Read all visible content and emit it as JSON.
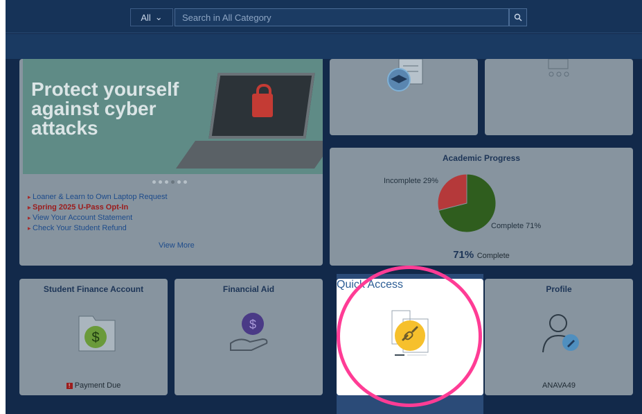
{
  "search": {
    "scope": "All",
    "placeholder": "Search in All Category"
  },
  "banner": {
    "headline": "Protect yourself against cyber attacks"
  },
  "links": [
    {
      "label": "Loaner & Learn to Own Laptop Request"
    },
    {
      "label": "Spring 2025 U-Pass Opt-In"
    },
    {
      "label": "View Your Account Statement"
    },
    {
      "label": "Check Your Student Refund"
    }
  ],
  "view_more": "View More",
  "academic_progress": {
    "title": "Academic Progress",
    "incomplete_label": "Incomplete 29%",
    "complete_label": "Complete 71%",
    "percent": "71%",
    "percent_suffix": "Complete",
    "colors": {
      "complete": "#2f5d1e",
      "incomplete": "#b5393a"
    }
  },
  "chart_data": {
    "type": "pie",
    "categories": [
      "Complete",
      "Incomplete"
    ],
    "values": [
      71,
      29
    ],
    "title": "Academic Progress"
  },
  "tiles": {
    "student_finance": {
      "title": "Student Finance Account",
      "status": "Payment Due"
    },
    "financial_aid": {
      "title": "Financial Aid"
    },
    "quick_access": {
      "title": "Quick Access"
    },
    "profile": {
      "title": "Profile",
      "username": "ANAVA49"
    }
  },
  "colors": {
    "page_bg": "#12294a",
    "tile_bg": "#87949f",
    "accent": "#ff3c95"
  }
}
